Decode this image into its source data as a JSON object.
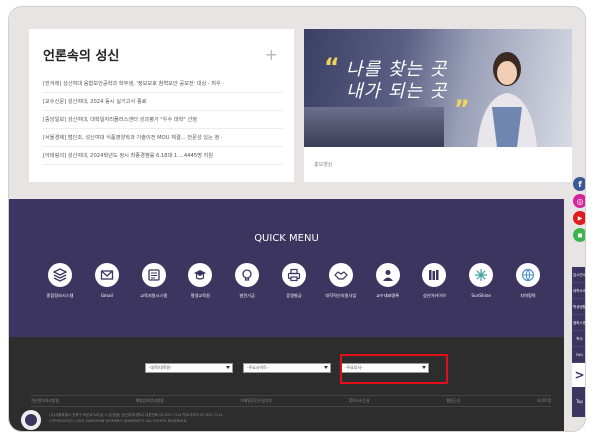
{
  "news": {
    "title": "언론속의 성신",
    "plus": "+",
    "items": [
      "[한겨레] 성신여대 융합보안공학과 학부생, '정보보호 참혁보안 공모전' 대상 · 최우 ·",
      "[교수신문] 성신여대, 2024 동시 실기고사 종료",
      "[중앙일보] 성신여대, 대학일자리플러스센터 성과평가 \"우수 대학\" 선정",
      "[서울경제] 범인조, 성신여대 식품영양학과 기술이전 MOU 체결... 전문성 있는 정 ·",
      "[아데링의] 성신여대, 2024학년도 정시 최종경쟁률 6.18대 1 ...4445명 지원"
    ]
  },
  "promo": {
    "line1": "나를 찾는 곳",
    "line2": "내가 되는 곳",
    "quote_open": "“",
    "quote_close": "”",
    "caption": "홍보영상"
  },
  "quick_menu": {
    "title": "QUICK MENU",
    "items": [
      {
        "label": "종합정보시스템",
        "icon": "layers-icon"
      },
      {
        "label": "Gmail",
        "icon": "mail-icon"
      },
      {
        "label": "교육지원시스템",
        "icon": "calendar-icon"
      },
      {
        "label": "평생교육원",
        "icon": "graduation-cap-icon"
      },
      {
        "label": "발전기금",
        "icon": "lightbulb-icon"
      },
      {
        "label": "증명발급",
        "icon": "printer-icon"
      },
      {
        "label": "대학혁신지원사업",
        "icon": "handshake-icon"
      },
      {
        "label": "교수대표명록",
        "icon": "people-icon"
      },
      {
        "label": "성신아카이브",
        "icon": "books-icon"
      },
      {
        "label": "SunShine",
        "icon": "sun-icon"
      },
      {
        "label": "지역협력",
        "icon": "globe-icon"
      }
    ]
  },
  "footer": {
    "selects": [
      "-대학/대학원-",
      "-주요사이트-",
      "-주요부서-"
    ],
    "links": [
      "개인정보처리방침",
      "해킹방지안내방침",
      "이메일무단수집거부",
      "찾아오시는길",
      "웹접근성",
      "사이트맵"
    ],
    "info1": "(주)서울특별시 성북구 보문로34다길 2 (돈암동) 성신여자대학교 대표전화 02-920-7114 학교사무처 02-920-7114",
    "info2": "COPYRIGHT(C) 2024 SUNGSHIN WOMEN'S UNIVERSITY. ALL RIGHTS RESERVED."
  },
  "sidebar": {
    "social": [
      {
        "name": "facebook",
        "glyph": "f",
        "color": "#3b5998"
      },
      {
        "name": "instagram",
        "glyph": "◎",
        "color": "#d6249f"
      },
      {
        "name": "youtube",
        "glyph": "▶",
        "color": "#e01b1b"
      },
      {
        "name": "kakao",
        "glyph": "◼",
        "color": "#3fb34f"
      }
    ],
    "menu": [
      "입시안내",
      "대학소개",
      "학생생활",
      "캠퍼스맵",
      "학사",
      "FAQ"
    ],
    "arrow": ">",
    "top": "Top"
  },
  "colors": {
    "brand_purple": "#3c3560",
    "highlight_red": "#e0101b",
    "footer_bg": "#2d2d2d"
  }
}
